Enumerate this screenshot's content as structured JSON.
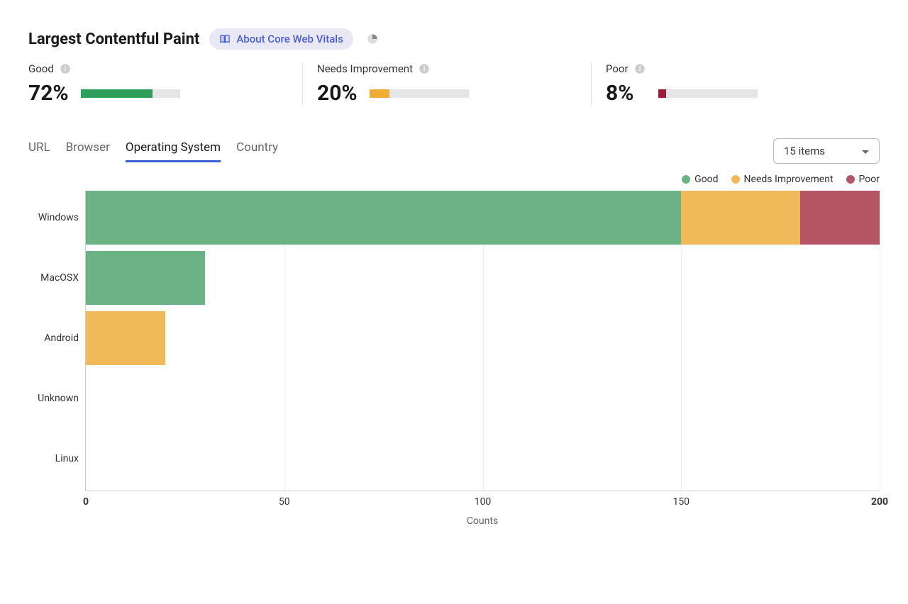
{
  "header": {
    "title": "Largest Contentful Paint",
    "about_label": "About Core Web Vitals"
  },
  "metrics": [
    {
      "label": "Good",
      "value": "72%",
      "pct": 72,
      "color": "#2E9E5B"
    },
    {
      "label": "Needs Improvement",
      "value": "20%",
      "pct": 20,
      "color": "#F0AD33"
    },
    {
      "label": "Poor",
      "value": "8%",
      "pct": 8,
      "color": "#9E1C3A"
    }
  ],
  "tabs": [
    {
      "label": "URL",
      "active": false
    },
    {
      "label": "Browser",
      "active": false
    },
    {
      "label": "Operating System",
      "active": true
    },
    {
      "label": "Country",
      "active": false
    }
  ],
  "dropdown": {
    "label": "15 items"
  },
  "legend": [
    {
      "label": "Good",
      "color": "#6BB385"
    },
    {
      "label": "Needs Improvement",
      "color": "#F0B95A"
    },
    {
      "label": "Poor",
      "color": "#B55464"
    }
  ],
  "chart_data": {
    "type": "bar",
    "orientation": "horizontal",
    "stacked": true,
    "categories": [
      "Windows",
      "MacOSX",
      "Android",
      "Unknown",
      "Linux"
    ],
    "series": [
      {
        "name": "Good",
        "values": [
          150,
          30,
          0,
          0,
          0
        ],
        "color": "#6BB385"
      },
      {
        "name": "Needs Improvement",
        "values": [
          30,
          0,
          20,
          0,
          0
        ],
        "color": "#F0B95A"
      },
      {
        "name": "Poor",
        "values": [
          20,
          0,
          0,
          0,
          0
        ],
        "color": "#B55464"
      }
    ],
    "xlabel": "Counts",
    "ylabel": "",
    "xlim": [
      0,
      200
    ],
    "xticks": [
      0,
      50,
      100,
      150,
      200
    ]
  }
}
